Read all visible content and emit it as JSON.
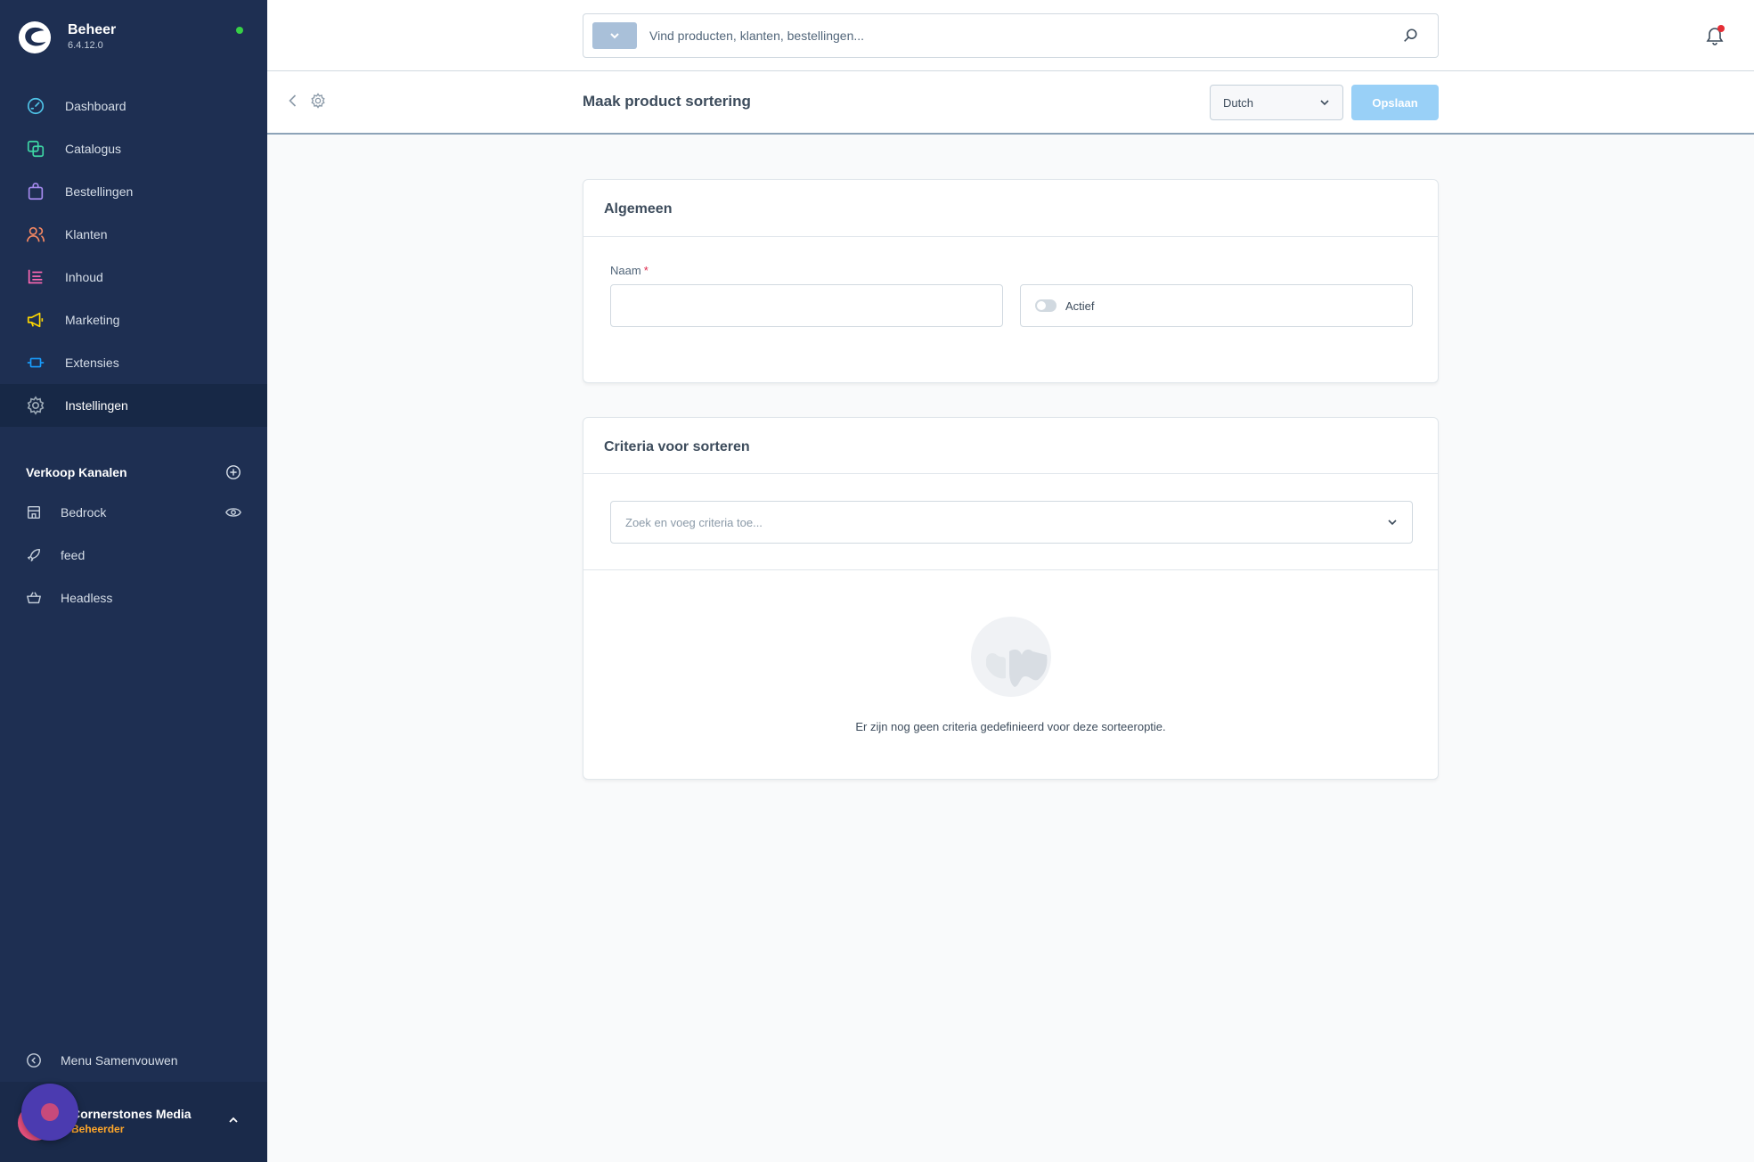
{
  "brand": {
    "title": "Beheer",
    "version": "6.4.12.0"
  },
  "nav": {
    "items": [
      {
        "label": "Dashboard",
        "icon": "dashboard-icon",
        "color": "#4fc4e8"
      },
      {
        "label": "Catalogus",
        "icon": "catalog-icon",
        "color": "#3ed6a5"
      },
      {
        "label": "Bestellingen",
        "icon": "bag-icon",
        "color": "#a68bf0"
      },
      {
        "label": "Klanten",
        "icon": "users-icon",
        "color": "#f88962"
      },
      {
        "label": "Inhoud",
        "icon": "content-icon",
        "color": "#ff68b4"
      },
      {
        "label": "Marketing",
        "icon": "megaphone-icon",
        "color": "#ffd700"
      },
      {
        "label": "Extensies",
        "icon": "plug-icon",
        "color": "#189eff"
      },
      {
        "label": "Instellingen",
        "icon": "gear-icon",
        "color": "#9aa8b5"
      }
    ]
  },
  "sales_channels": {
    "title": "Verkoop Kanalen",
    "items": [
      {
        "label": "Bedrock",
        "icon": "storefront-icon"
      },
      {
        "label": "feed",
        "icon": "rocket-icon"
      },
      {
        "label": "Headless",
        "icon": "basket-icon"
      }
    ]
  },
  "sidebar_footer": {
    "collapse_label": "Menu Samenvouwen",
    "user_name": "Cornerstones Media",
    "user_role": "Beheerder"
  },
  "topbar": {
    "search_placeholder": "Vind producten, klanten, bestellingen..."
  },
  "smartbar": {
    "title": "Maak product sortering",
    "language": "Dutch",
    "save_label": "Opslaan"
  },
  "general": {
    "title": "Algemeen",
    "name_label": "Naam",
    "required_mark": "*",
    "name_value": "",
    "active_label": "Actief",
    "active": false
  },
  "criteria": {
    "title": "Criteria voor sorteren",
    "select_placeholder": "Zoek en voeg criteria toe...",
    "empty_text": "Er zijn nog geen criteria gedefinieerd voor deze sorteeroptie."
  },
  "colors": {
    "sidebar": "#1e2f52",
    "accent": "#189eff",
    "save_disabled": "#99d0f7",
    "status_online": "#37d046",
    "notification": "#e52d35",
    "user_role": "#ffa72a"
  }
}
